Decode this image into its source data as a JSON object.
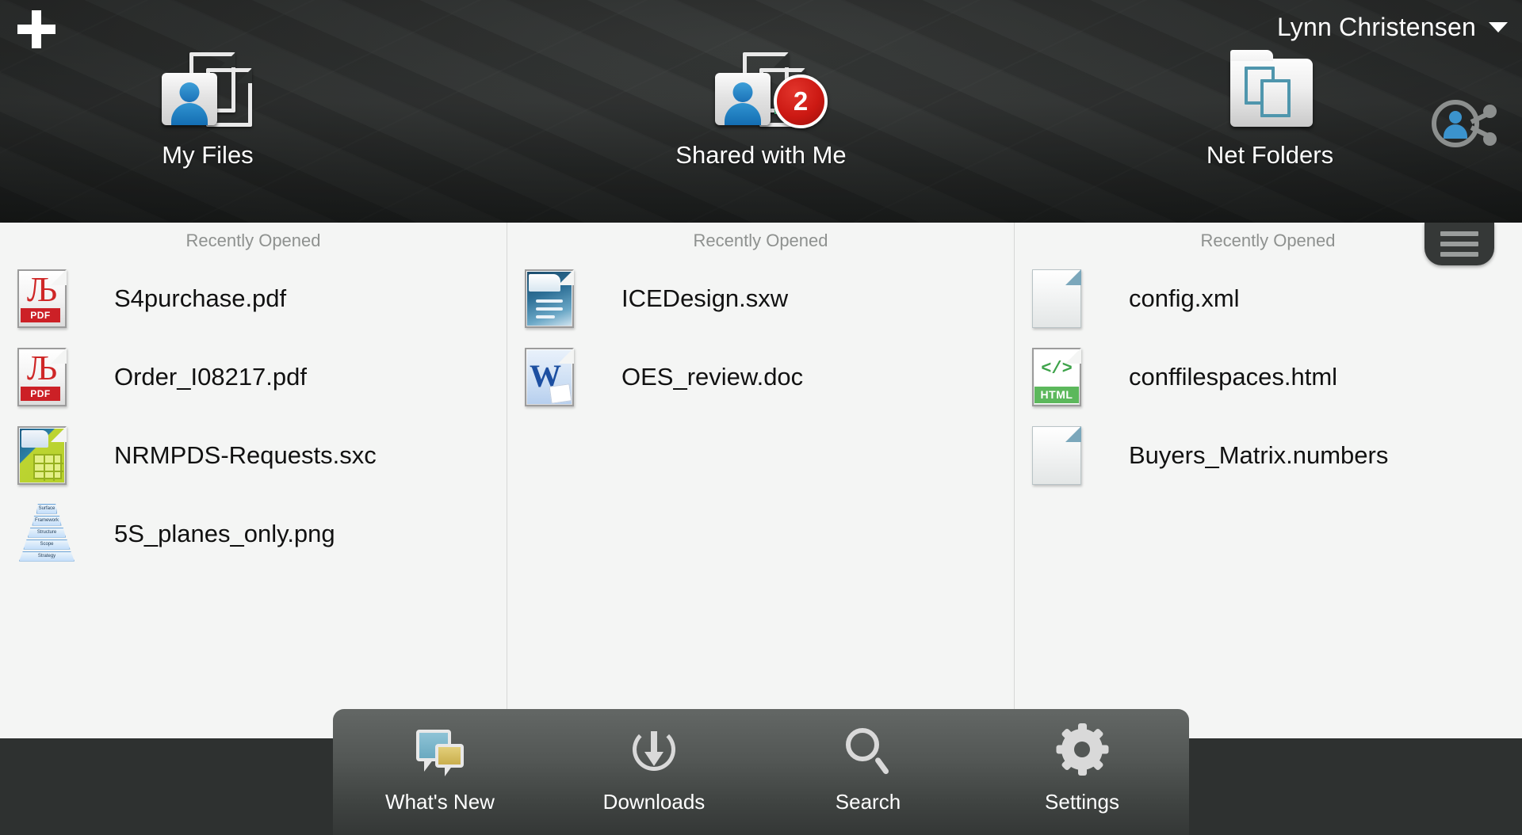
{
  "header": {
    "add_label": "+",
    "user_name": "Lynn Christensen",
    "tabs": [
      {
        "label": "My Files",
        "icon": "people-documents-icon",
        "badge": null
      },
      {
        "label": "Shared with Me",
        "icon": "shared-documents-icon",
        "badge": "2"
      },
      {
        "label": "Net Folders",
        "icon": "network-folder-icon",
        "badge": null
      }
    ],
    "share_icon": "share-people-network-icon",
    "menu_icon": "hamburger-menu-icon"
  },
  "columns": [
    {
      "section_label": "Recently Opened",
      "files": [
        {
          "name": "S4purchase.pdf",
          "icon": "pdf-file-icon"
        },
        {
          "name": "Order_I08217.pdf",
          "icon": "pdf-file-icon"
        },
        {
          "name": "NRMPDS-Requests.sxc",
          "icon": "calc-spreadsheet-file-icon"
        },
        {
          "name": "5S_planes_only.png",
          "icon": "image-thumbnail-pyramid"
        }
      ]
    },
    {
      "section_label": "Recently Opened",
      "files": [
        {
          "name": "ICEDesign.sxw",
          "icon": "writer-document-file-icon"
        },
        {
          "name": "OES_review.doc",
          "icon": "word-document-file-icon"
        }
      ]
    },
    {
      "section_label": "Recently Opened",
      "files": [
        {
          "name": "config.xml",
          "icon": "generic-file-icon"
        },
        {
          "name": "conffilespaces.html",
          "icon": "html-file-icon"
        },
        {
          "name": "Buyers_Matrix.numbers",
          "icon": "generic-file-icon"
        }
      ]
    }
  ],
  "pyramid_levels": [
    "Surface",
    "Framework",
    "Structure",
    "Scope",
    "Strategy"
  ],
  "html_icon": {
    "code": "</>",
    "tag": "HTML"
  },
  "pdf_icon": {
    "glyph": "Љ",
    "tag": "PDF"
  },
  "word_icon": {
    "letter": "W"
  },
  "toolbar": {
    "items": [
      {
        "label": "What's New",
        "icon": "speech-bubbles-icon"
      },
      {
        "label": "Downloads",
        "icon": "download-arrow-icon"
      },
      {
        "label": "Search",
        "icon": "magnifier-icon"
      },
      {
        "label": "Settings",
        "icon": "gear-icon"
      }
    ]
  },
  "colors": {
    "header_dark": "#2e3130",
    "content_bg": "#f4f5f4",
    "badge_red": "#cc1913",
    "accent_blue": "#2f93d0",
    "toolbar_gray": "#535755"
  }
}
